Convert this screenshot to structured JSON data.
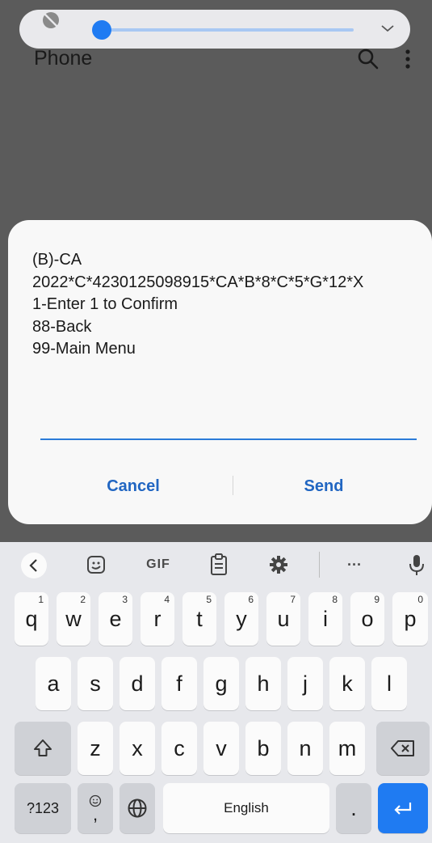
{
  "app": {
    "title": "Phone"
  },
  "dialog": {
    "message_lines": [
      "(B)-CA",
      "2022*C*4230125098915*CA*B*8*C*5*G*12*X",
      "1-Enter 1 to Confirm",
      "88-Back",
      "99-Main Menu"
    ],
    "input_value": "",
    "cancel_label": "Cancel",
    "send_label": "Send"
  },
  "volume": {
    "level": 0.02,
    "accent": "#1f7bf2"
  },
  "keyboard": {
    "toolbar": {
      "gif_label": "GIF",
      "more_label": "···"
    },
    "row1": [
      {
        "letter": "q",
        "num": "1"
      },
      {
        "letter": "w",
        "num": "2"
      },
      {
        "letter": "e",
        "num": "3"
      },
      {
        "letter": "r",
        "num": "4"
      },
      {
        "letter": "t",
        "num": "5"
      },
      {
        "letter": "y",
        "num": "6"
      },
      {
        "letter": "u",
        "num": "7"
      },
      {
        "letter": "i",
        "num": "8"
      },
      {
        "letter": "o",
        "num": "9"
      },
      {
        "letter": "p",
        "num": "0"
      }
    ],
    "row2": [
      "a",
      "s",
      "d",
      "f",
      "g",
      "h",
      "j",
      "k",
      "l"
    ],
    "row3": [
      "z",
      "x",
      "c",
      "v",
      "b",
      "n",
      "m"
    ],
    "symbols_label": "?123",
    "emoji_comma_label": ",",
    "space_label": "English",
    "period_label": ".",
    "accent_color": "#1f7bf2"
  }
}
